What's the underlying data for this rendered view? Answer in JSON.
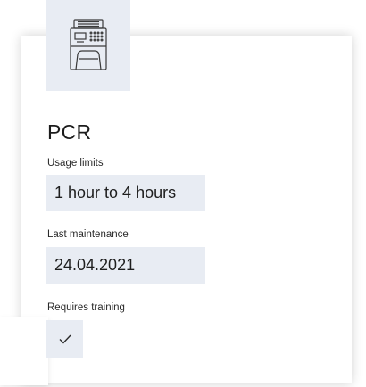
{
  "equipment": {
    "name": "PCR",
    "icon": "pcr-machine-icon",
    "usage_limits": {
      "label": "Usage limits",
      "value": "1 hour to 4 hours"
    },
    "last_maintenance": {
      "label": "Last maintenance",
      "value": "24.04.2021"
    },
    "requires_training": {
      "label": "Requires training",
      "checked": true,
      "icon": "checkmark-icon"
    }
  },
  "colors": {
    "field_background": "#e8ecf3",
    "card_background": "#ffffff",
    "text": "#1c1c1c"
  }
}
